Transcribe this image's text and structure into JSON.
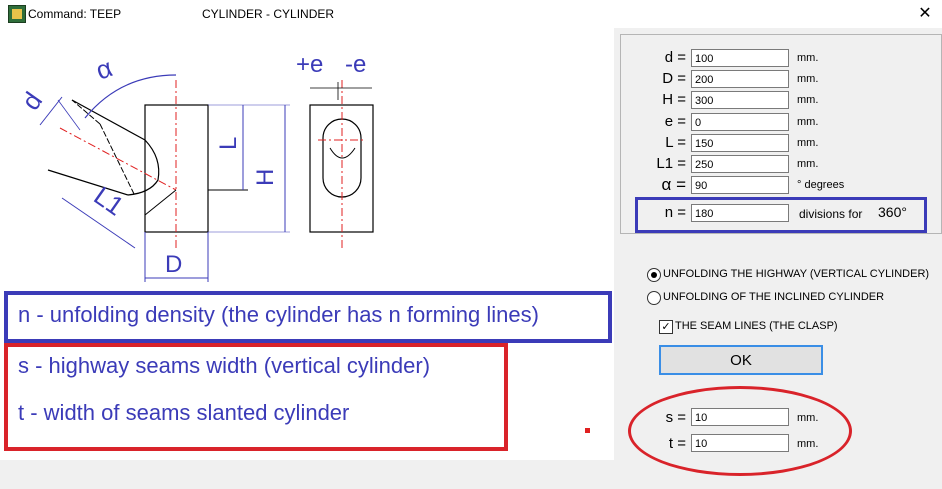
{
  "window": {
    "command": "Command: TEEP",
    "title": "CYLINDER - CYLINDER",
    "close_label": "✕"
  },
  "drawing": {
    "alpha": "α",
    "d": "d",
    "L1": "L1",
    "D": "D",
    "L": "L",
    "H": "H",
    "plus_e": "+e",
    "minus_e": "-e"
  },
  "params": [
    {
      "label": "d =",
      "value": "100",
      "unit": "mm."
    },
    {
      "label": "D =",
      "value": "200",
      "unit": "mm."
    },
    {
      "label": "H =",
      "value": "300",
      "unit": "mm."
    },
    {
      "label": "e =",
      "value": "0",
      "unit": "mm."
    },
    {
      "label": "L =",
      "value": "150",
      "unit": "mm."
    },
    {
      "label": "L1 =",
      "value": "250",
      "unit": "mm."
    },
    {
      "label": "α =",
      "value": "90",
      "unit": "°  degrees"
    }
  ],
  "divisions": {
    "label": "n =",
    "value": "180",
    "unit": "divisions for",
    "total": "360°"
  },
  "options": {
    "radio1": "UNFOLDING THE HIGHWAY (VERTICAL CYLINDER)",
    "radio2": "UNFOLDING OF THE INCLINED CYLINDER",
    "checkbox": "THE SEAM LINES (THE  CLASP)",
    "ok": "OK"
  },
  "seams": [
    {
      "label": "s =",
      "value": "10",
      "unit": "mm."
    },
    {
      "label": "t =",
      "value": "10",
      "unit": "mm."
    }
  ],
  "annotations": {
    "n_text": "n - unfolding density (the cylinder has n forming lines)",
    "s_text": "s - highway seams width (vertical cylinder)",
    "t_text": "t - width of seams slanted cylinder"
  },
  "colors": {
    "blue": "#3b3bb8",
    "red": "#d9232a",
    "centerline": "#e02020"
  }
}
